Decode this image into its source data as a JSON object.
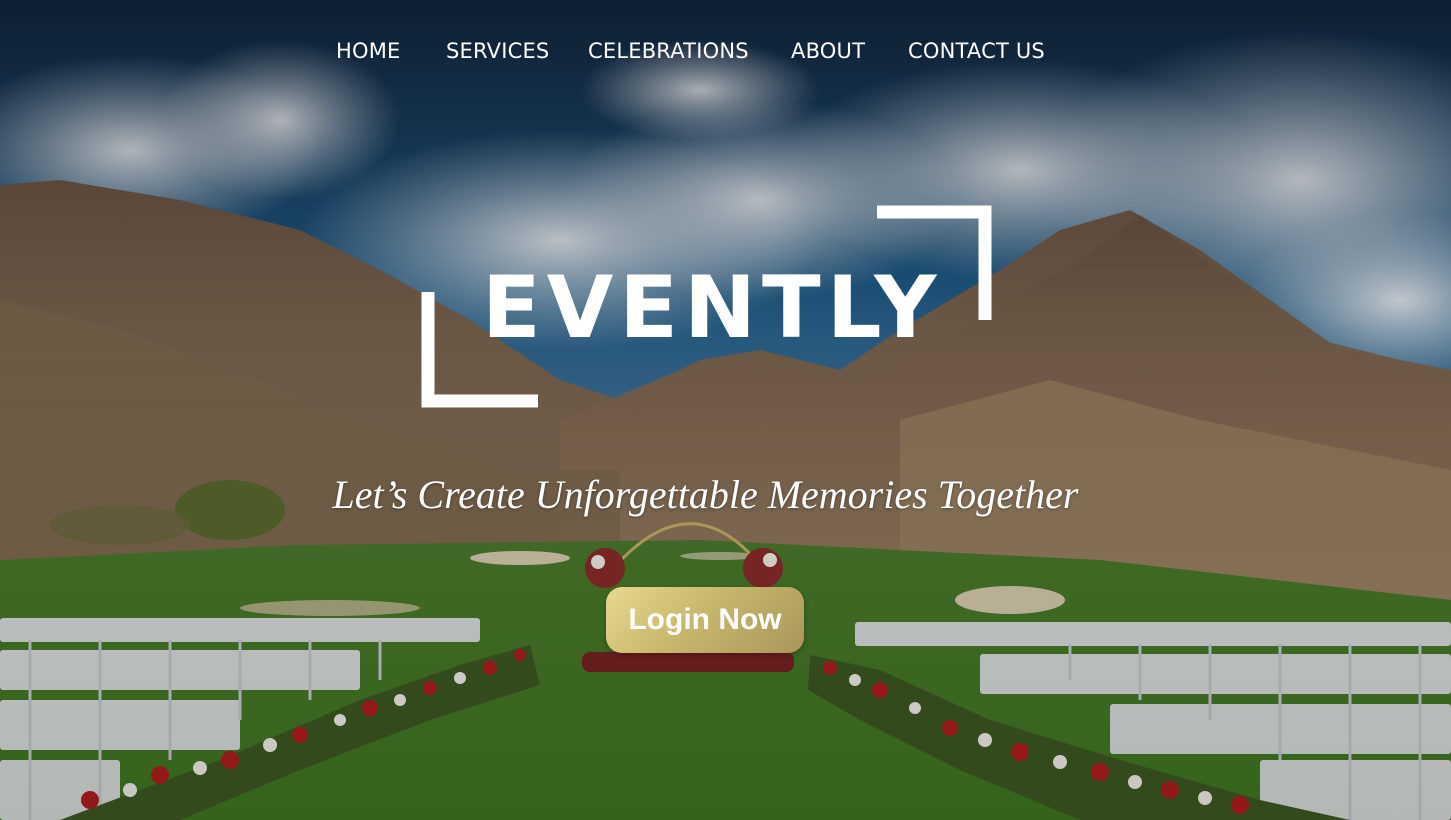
{
  "nav": {
    "items": [
      {
        "label": "HOME"
      },
      {
        "label": "SERVICES"
      },
      {
        "label": "CELEBRATIONS"
      },
      {
        "label": "ABOUT"
      },
      {
        "label": "CONTACT US"
      }
    ]
  },
  "hero": {
    "logo_text": "EVENTLY",
    "tagline": "Let’s Create Unforgettable Memories Together",
    "login_label": "Login Now"
  },
  "colors": {
    "button_gold": "#c8b76c",
    "text_white": "#ffffff"
  }
}
